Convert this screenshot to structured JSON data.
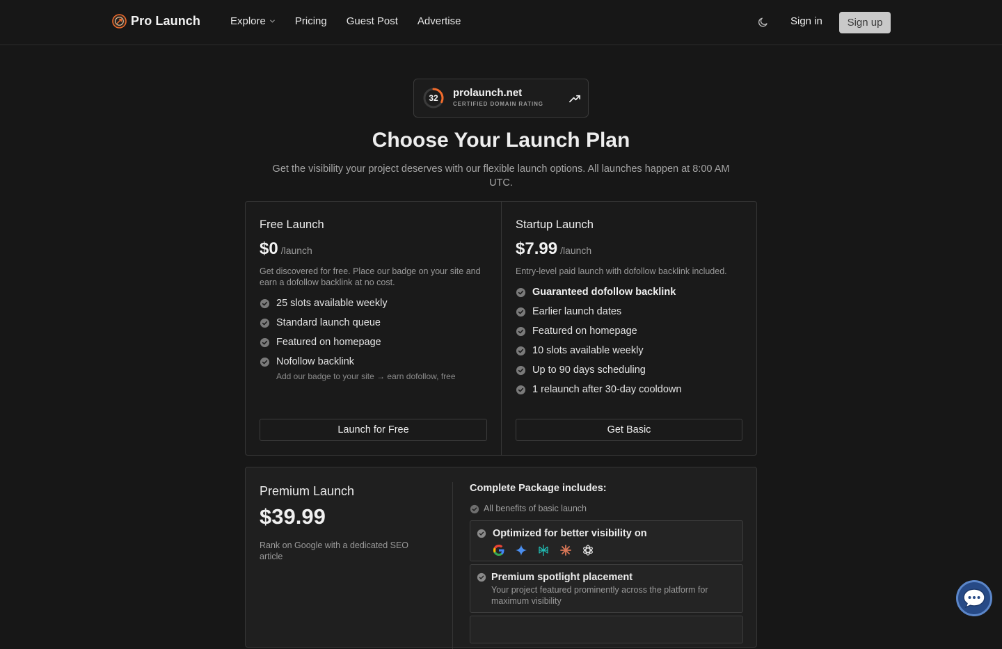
{
  "header": {
    "brand": "Pro Launch",
    "nav": {
      "explore": "Explore",
      "pricing": "Pricing",
      "guest_post": "Guest Post",
      "advertise": "Advertise"
    },
    "sign_in": "Sign in",
    "sign_up": "Sign up"
  },
  "domain_badge": {
    "rating": "32",
    "rating_fraction": 0.32,
    "domain": "prolaunch.net",
    "label": "CERTIFIED DOMAIN RATING"
  },
  "hero": {
    "title": "Choose Your Launch Plan",
    "subtitle": "Get the visibility your project deserves with our flexible launch options. All launches happen at 8:00 AM UTC."
  },
  "plans": {
    "free": {
      "name": "Free Launch",
      "price": "$0",
      "per": "/launch",
      "description": "Get discovered for free. Place our badge on your site and earn a dofollow backlink at no cost.",
      "features": [
        "25 slots available weekly",
        "Standard launch queue",
        "Featured on homepage",
        "Nofollow backlink"
      ],
      "feature_note": "Add our badge to your site → earn dofollow, free",
      "cta": "Launch for Free"
    },
    "startup": {
      "name": "Startup Launch",
      "price": "$7.99",
      "per": "/launch",
      "description": "Entry-level paid launch with dofollow backlink included.",
      "features": [
        "Guaranteed dofollow backlink",
        "Earlier launch dates",
        "Featured on homepage",
        "10 slots available weekly",
        "Up to 90 days scheduling",
        "1 relaunch after 30-day cooldown"
      ],
      "cta": "Get Basic"
    },
    "premium": {
      "name": "Premium Launch",
      "price": "$39.99",
      "description": "Rank on Google with a dedicated SEO article",
      "includes_heading": "Complete Package includes:",
      "basic_benefits": "All benefits of basic launch",
      "visibility_title": "Optimized for better visibility on",
      "visibility_icons": [
        "google-icon",
        "gemini-icon",
        "perplexity-icon",
        "claude-icon",
        "openai-icon"
      ],
      "spotlight_title": "Premium spotlight placement",
      "spotlight_text": "Your project featured prominently across the platform for maximum visibility"
    }
  },
  "colors": {
    "background": "#171717",
    "accent_orange": "#f26b2b",
    "sign_up_bg": "#c9c9c9",
    "chat_blue": "#274a86"
  }
}
